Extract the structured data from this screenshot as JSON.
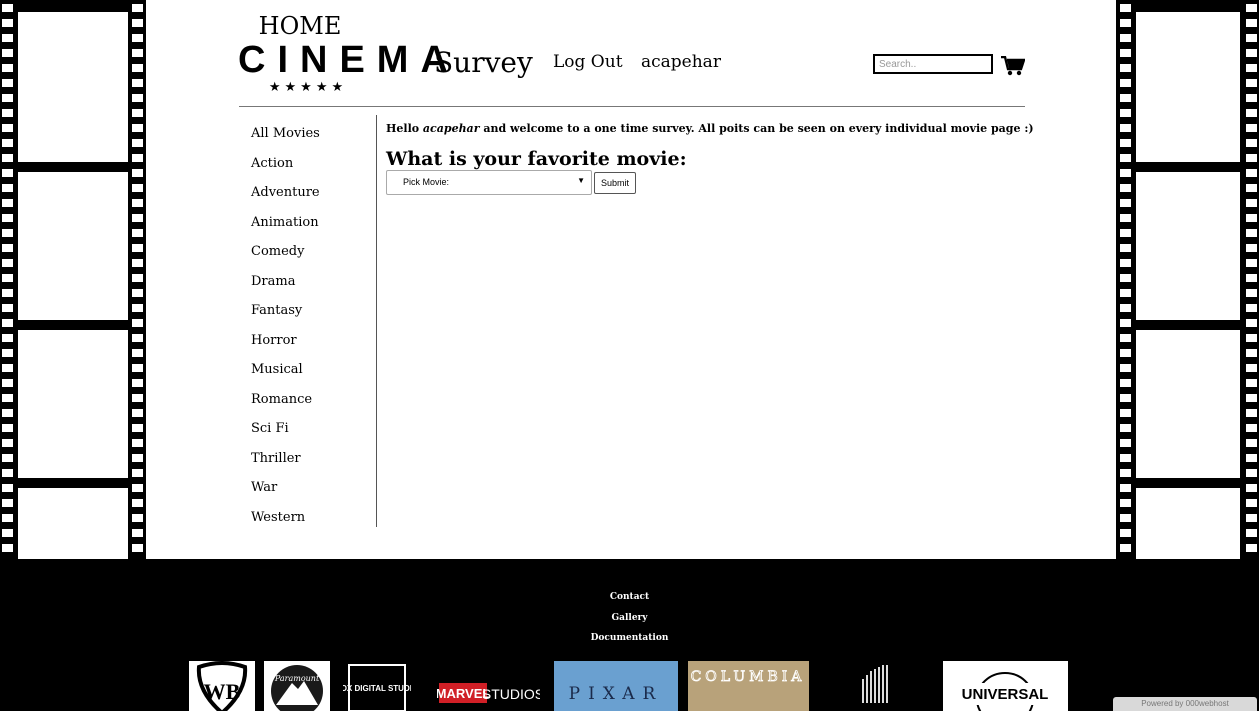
{
  "logo": {
    "home": "HOME",
    "cinema": "CINEMA",
    "stars": "★★★★★"
  },
  "nav": {
    "survey": "Survey",
    "logout": "Log Out",
    "username": "acapehar"
  },
  "search": {
    "placeholder": "Search.."
  },
  "icons": {
    "cart": "shopping-cart-icon",
    "dropdown": "chevron-down-icon"
  },
  "sidebar": {
    "items": [
      {
        "label": "All Movies"
      },
      {
        "label": "Action"
      },
      {
        "label": "Adventure"
      },
      {
        "label": "Animation"
      },
      {
        "label": "Comedy"
      },
      {
        "label": "Drama"
      },
      {
        "label": "Fantasy"
      },
      {
        "label": "Horror"
      },
      {
        "label": "Musical"
      },
      {
        "label": "Romance"
      },
      {
        "label": "Sci Fi"
      },
      {
        "label": "Thriller"
      },
      {
        "label": "War"
      },
      {
        "label": "Western"
      }
    ]
  },
  "survey": {
    "greeting_pre": "Hello ",
    "greeting_user": "acapehar",
    "greeting_post": " and welcome to a one time survey. All poits can be seen on every individual movie page :)",
    "question": "What is your favorite movie:",
    "select_value": "Pick Movie:",
    "submit": "Submit"
  },
  "footer": {
    "links": [
      {
        "label": "Contact"
      },
      {
        "label": "Gallery"
      },
      {
        "label": "Documentation"
      }
    ],
    "brands": {
      "wb": "WB",
      "paramount": "Paramount",
      "fox": "FOX DIGITAL STUDIO",
      "marvel_a": "MARVEL",
      "marvel_b": "STUDIOS",
      "pixar": "PIXAR",
      "columbia": "COLUMBIA",
      "universal": "UNIVERSAL"
    },
    "powered": "Powered by 000webhost"
  },
  "colors": {
    "footer_bg": "#000000",
    "columbia_bg": "#9a8a6a",
    "pixar_bg": "#6aa0d0",
    "marvel_red": "#d01f26"
  }
}
